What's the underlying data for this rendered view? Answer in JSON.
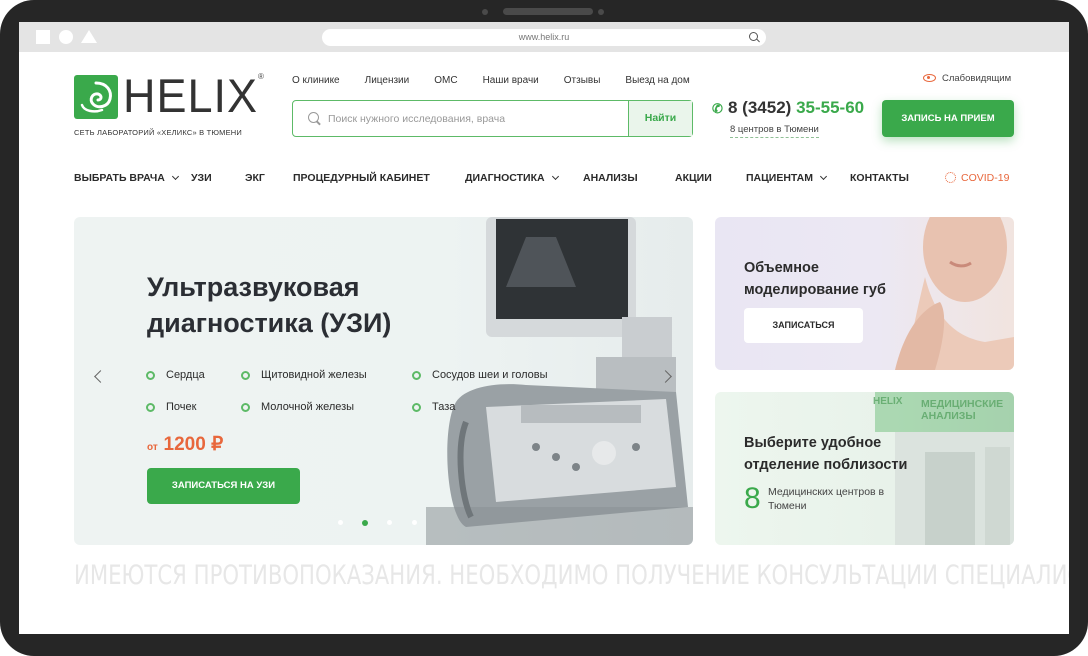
{
  "browser": {
    "url": "www.helix.ru"
  },
  "logo": {
    "word": "HELIX",
    "reg": "®",
    "subtitle": "СЕТЬ ЛАБОРАТОРИЙ «ХЕЛИКС» В ТЮМЕНИ"
  },
  "topnav": [
    "О клинике",
    "Лицензии",
    "ОМС",
    "Наши врачи",
    "Отзывы",
    "Выезд на дом"
  ],
  "accessibility": {
    "label": "Слабовидящим"
  },
  "search": {
    "placeholder": "Поиск нужного исследования, врача",
    "value": "",
    "button": "Найти"
  },
  "contact": {
    "phone_prefix": "8 (3452)",
    "phone_main": "35-55-60",
    "centers_link": "8 центров в Тюмени"
  },
  "header_button": "ЗАПИСЬ НА ПРИЕМ",
  "mainnav": {
    "items": [
      "ВЫБРАТЬ ВРАЧА",
      "УЗИ",
      "ЭКГ",
      "ПРОЦЕДУРНЫЙ КАБИНЕТ",
      "ДИАГНОСТИКА",
      "АНАЛИЗЫ",
      "АКЦИИ",
      "ПАЦИЕНТАМ",
      "КОНТАКТЫ"
    ],
    "covid": "COVID-19"
  },
  "hero": {
    "title": "Ультразвуковая диагностика (УЗИ)",
    "list": [
      "Сердца",
      "Щитовидной железы",
      "Сосудов шеи и головы",
      "Почек",
      "Молочной железы",
      "Таза"
    ],
    "price_prefix": "от",
    "price": "1200 ₽",
    "button": "ЗАПИСАТЬСЯ НА УЗИ",
    "slides_total": 4,
    "slide_active": 2
  },
  "card_lips": {
    "title": "Объемное моделирование губ",
    "button": "ЗАПИСАТЬСЯ"
  },
  "card_office": {
    "title": "Выберите удобное отделение поблизости",
    "count": "8",
    "count_text": "Медицинских центров в Тюмени",
    "sign_brand": "HELIX",
    "sign_text": "МЕДИЦИНСКИЕ АНАЛИЗЫ"
  },
  "disclaimer": "ИМЕЮТСЯ ПРОТИВОПОКАЗАНИЯ. НЕОБХОДИМО ПОЛУЧЕНИЕ КОНСУЛЬТАЦИИ СПЕЦИАЛИСТА",
  "colors": {
    "brand_green": "#3aa94b",
    "accent_orange": "#e8673c",
    "text_dark": "#2b2b2b"
  }
}
